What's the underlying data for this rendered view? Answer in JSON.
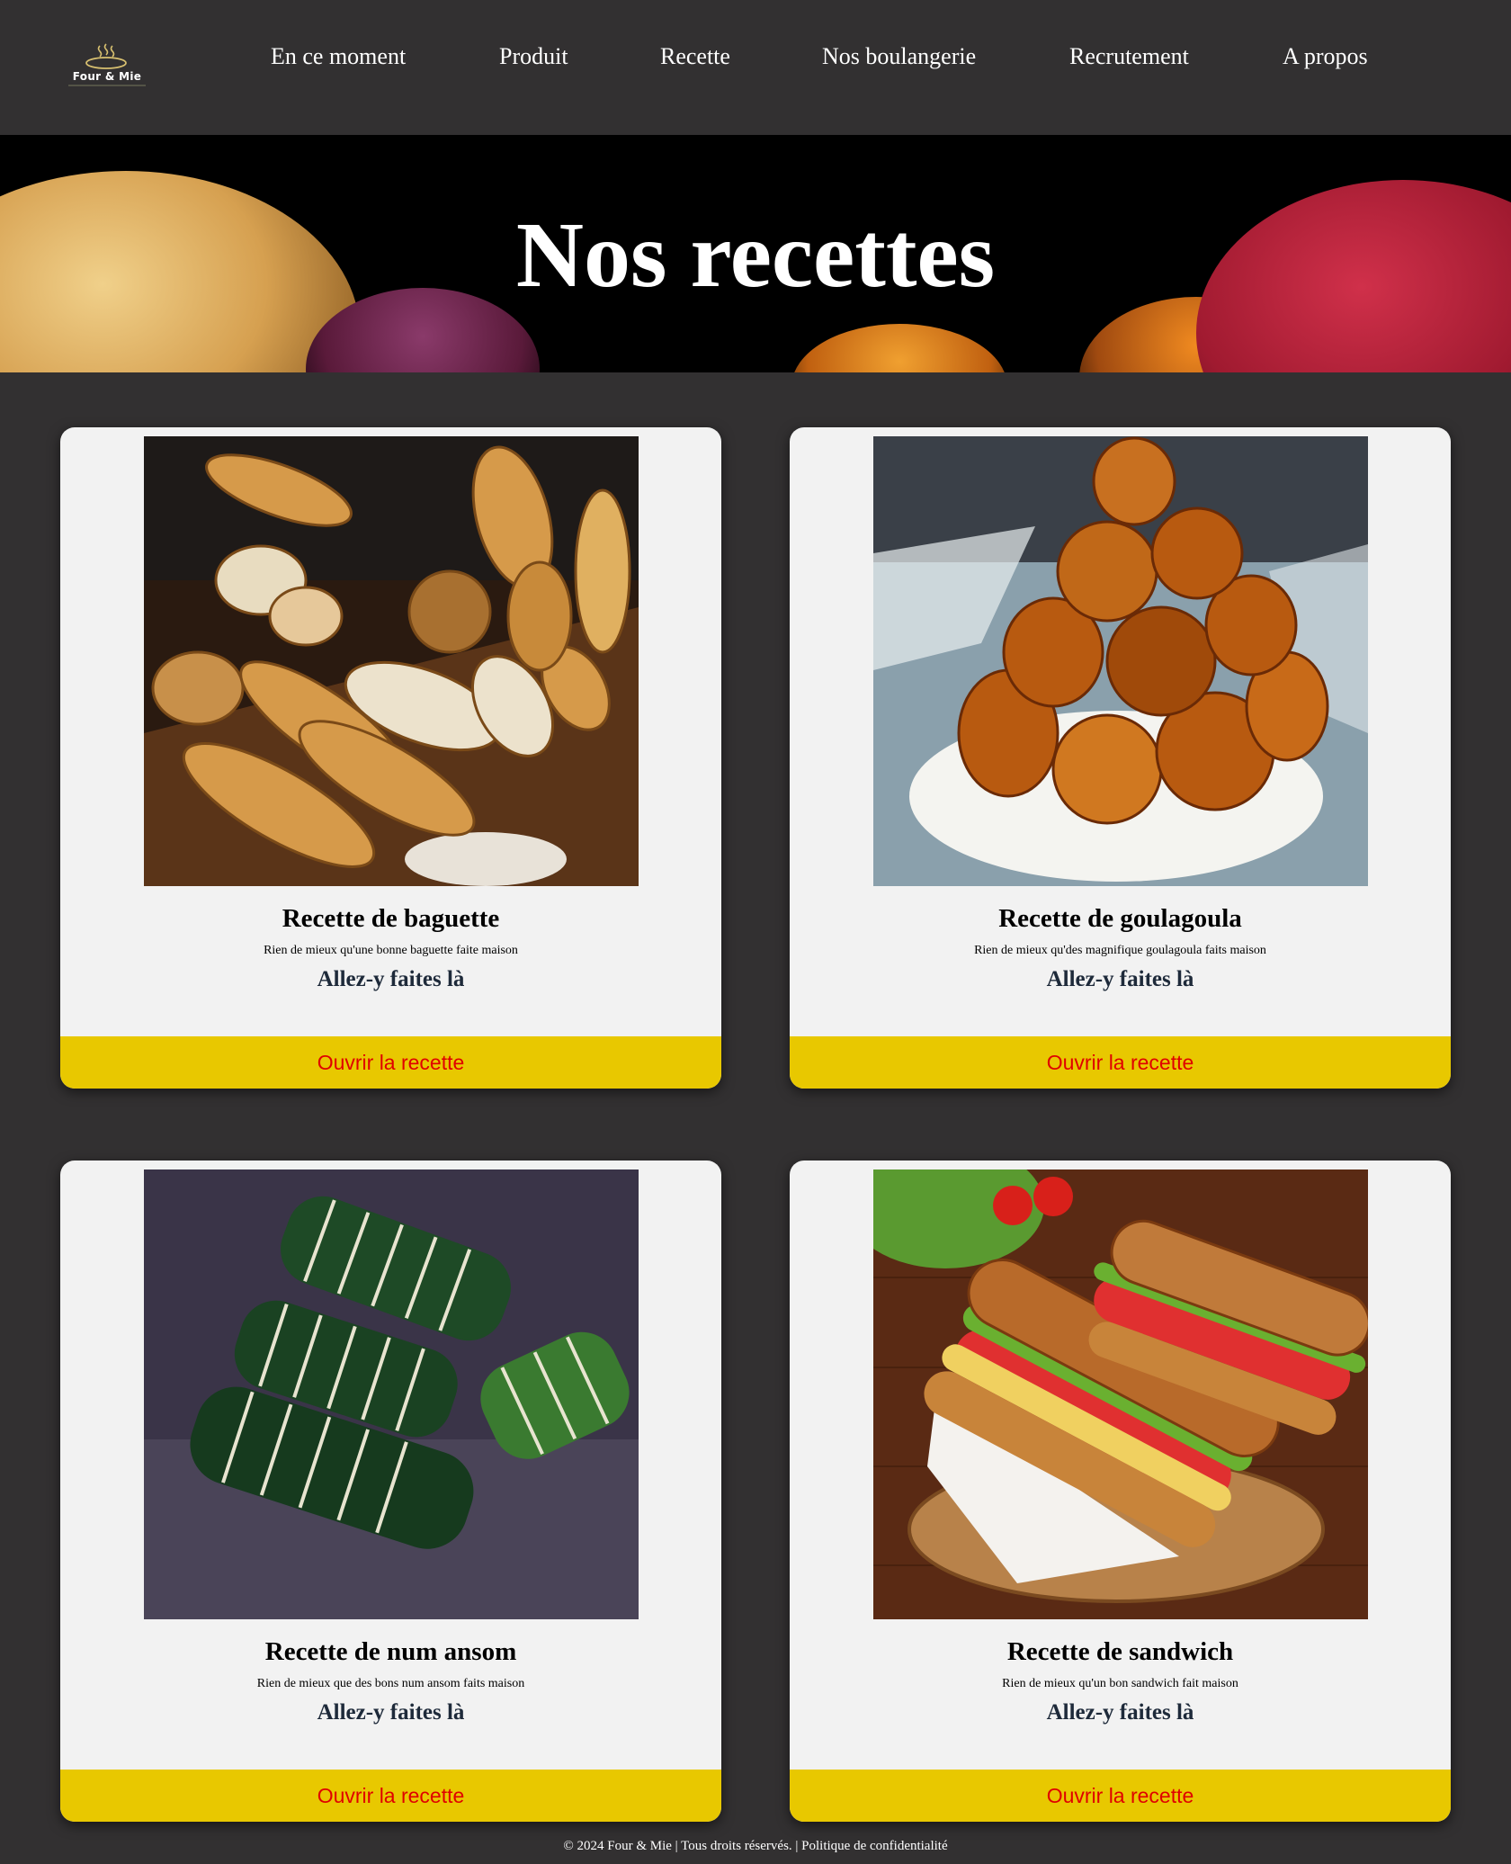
{
  "header": {
    "logo_text": "Four & Mie",
    "nav": [
      "En ce moment",
      "Produit",
      "Recette",
      "Nos boulangerie",
      "Recrutement",
      "A propos"
    ]
  },
  "banner": {
    "title": "Nos recettes"
  },
  "cards": [
    {
      "title": "Recette de baguette",
      "description": "Rien de mieux qu'une bonne baguette faite maison",
      "cta_text": "Allez-y faites là",
      "button": "Ouvrir la recette",
      "image": "bread-baguettes-image"
    },
    {
      "title": "Recette de goulagoula",
      "description": "Rien de mieux qu'des magnifique goulagoula faits maison",
      "cta_text": "Allez-y faites là",
      "button": "Ouvrir la recette",
      "image": "fried-dough-balls-image"
    },
    {
      "title": "Recette de num ansom",
      "description": "Rien de mieux que des bons num ansom faits maison",
      "cta_text": "Allez-y faites là",
      "button": "Ouvrir la recette",
      "image": "leaf-wrapped-rice-cakes-image"
    },
    {
      "title": "Recette de sandwich",
      "description": "Rien de mieux qu'un bon sandwich fait maison",
      "cta_text": "Allez-y faites là",
      "button": "Ouvrir la recette",
      "image": "submarine-sandwich-image"
    }
  ],
  "footer": {
    "text": "© 2024 Four & Mie | Tous droits réservés. | Politique de confidentialité"
  },
  "colors": {
    "page_bg": "#323031",
    "card_bg": "#f2f2f2",
    "button_bg": "#e8c800",
    "button_text": "#e00000"
  }
}
